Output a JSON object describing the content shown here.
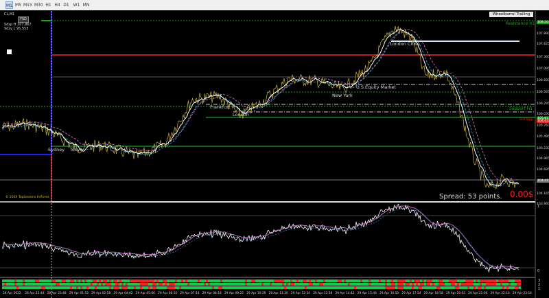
{
  "toolbar": {
    "timeframes": [
      "M1",
      "M5",
      "M15",
      "M30",
      "H1",
      "H4",
      "D1",
      "W1",
      "MN"
    ],
    "active_index": 0
  },
  "chart": {
    "symbol_label": "CL,M1",
    "button_label": "FSD",
    "stats": [
      "Sdsp H 107.867",
      "Sdsy L 95.553"
    ],
    "ea_title": "Wheelbarrel Trailing _v1.2",
    "sessions": [
      "Sydney",
      "Tokyo",
      "London",
      "Frankfurt",
      "New York",
      "U.S.Equity Market",
      "London Close"
    ],
    "resistance_label": "Resistance H1",
    "support_label": "Support H1",
    "sell_label": "Sell Stop",
    "spread_text": "Spread: 53 points.",
    "cost_text": "0.00$",
    "copyright": "© 2020 TopLessons.In/Forex",
    "price_axis": [
      "107.890",
      "107.625",
      "107.360",
      "107.095",
      "106.830",
      "106.565",
      "106.295",
      "106.030",
      "105.760",
      "105.495",
      "105.230",
      "104.965",
      "104.695",
      "104.165",
      "103.900"
    ],
    "price_tags": {
      "resistance": "108.101",
      "support": "105.877",
      "sell": "104.432",
      "current": "104.417"
    },
    "indicator_axis": [
      "1",
      "0"
    ],
    "time_axis": [
      "28 Apr 2022",
      "28 Apr 22:44",
      "28 Apr 23:48",
      "29 Apr 01:53",
      "29 Apr 02:58",
      "29 Apr 04:02",
      "29 Apr 05:06",
      "29 Apr 06:10",
      "29 Apr 07:14",
      "29 Apr 08:18",
      "29 Apr 09:22",
      "29 Apr 10:26",
      "29 Apr 11:30",
      "29 Apr 12:34",
      "29 Apr 13:38",
      "29 Apr 14:42",
      "29 Apr 15:46",
      "29 Apr 16:50",
      "29 Apr 17:54",
      "29 Apr 18:58",
      "29 Apr 20:02",
      "29 Apr 21:06",
      "29 Apr 22:10",
      "29 Apr 23:14"
    ],
    "bar_labels": [
      "3",
      "2",
      "1"
    ],
    "colors": {
      "price": "#b8a23a",
      "white_ma": "#ffffff",
      "blue_ma": "#29a3c9",
      "magenta_ma": "#d070d0",
      "resistance": "#ff2020",
      "support_green": "#1aa51a",
      "bull": "#18c850",
      "bear": "#ff2020",
      "session_blue": "#2020ff"
    }
  }
}
